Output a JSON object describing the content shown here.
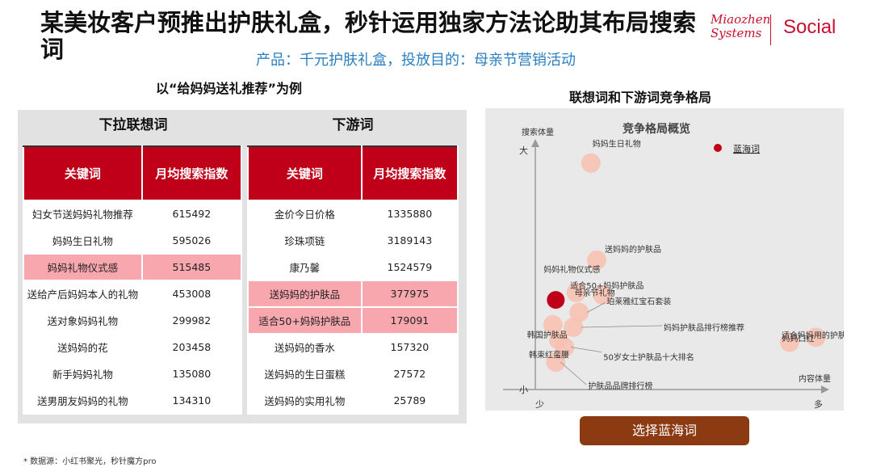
{
  "header": {
    "title": "某美妆客户预推出护肤礼盒，秒针运用独家方法论助其布局搜索词",
    "subtitle": "产品：千元护肤礼盒，投放目的：母亲节营销活动",
    "example": "以“给妈妈送礼推荐”为例"
  },
  "logo": {
    "miaozhen_line1": "Miaozhen",
    "miaozhen_line2": "Systems",
    "social": "Social"
  },
  "left_table": {
    "title": "下拉联想词",
    "col_keyword": "关键词",
    "col_index": "月均搜索指数",
    "rows": [
      {
        "kw": "妇女节送妈妈礼物推荐",
        "val": "615492"
      },
      {
        "kw": "妈妈生日礼物",
        "val": "595026"
      },
      {
        "kw": "妈妈礼物仪式感",
        "val": "515485"
      },
      {
        "kw": "送给产后妈妈本人的礼物",
        "val": "453008"
      },
      {
        "kw": "送对象妈妈礼物",
        "val": "299982"
      },
      {
        "kw": "送妈妈的花",
        "val": "203458"
      },
      {
        "kw": "新手妈妈礼物",
        "val": "135080"
      },
      {
        "kw": "送男朋友妈妈的礼物",
        "val": "134310"
      }
    ]
  },
  "right_table": {
    "title": "下游词",
    "col_keyword": "关键词",
    "col_index": "月均搜索指数",
    "rows": [
      {
        "kw": "金价今日价格",
        "val": "1335880"
      },
      {
        "kw": "珍珠项链",
        "val": "3189143"
      },
      {
        "kw": "康乃馨",
        "val": "1524579"
      },
      {
        "kw": "送妈妈的护肤品",
        "val": "377975"
      },
      {
        "kw": "适合50+妈妈护肤品",
        "val": "179091"
      },
      {
        "kw": "送妈妈的香水",
        "val": "157320"
      },
      {
        "kw": "送妈妈的生日蛋糕",
        "val": "27572"
      },
      {
        "kw": "送妈妈的实用礼物",
        "val": "25789"
      }
    ]
  },
  "chart_section_title": "联想词和下游词竞争格局",
  "chart_data": {
    "type": "scatter",
    "title": "竞争格局概览",
    "ylabel": "搜索体量",
    "xlabel": "内容体量",
    "y_high": "大",
    "y_low": "小",
    "x_low": "少",
    "x_high": "多",
    "legend": "蓝海词",
    "colors": {
      "bubble": "#f8c0b0",
      "blue_ocean": "#c00018",
      "axis": "#999999"
    },
    "points": [
      {
        "label": "妈妈生日礼物",
        "x": 0.19,
        "y": 0.91,
        "highlight": false
      },
      {
        "label": "送妈妈的护肤品",
        "x": 0.21,
        "y": 0.52,
        "highlight": false
      },
      {
        "label": "妈妈礼物仪式感",
        "x": 0.07,
        "y": 0.36,
        "highlight": true
      },
      {
        "label": "母亲节礼物",
        "x": 0.14,
        "y": 0.39,
        "highlight": false
      },
      {
        "label": "适合50+妈妈护肤品",
        "x": 0.23,
        "y": 0.38,
        "highlight": false
      },
      {
        "label": "珀莱雅红宝石套装",
        "x": 0.15,
        "y": 0.31,
        "highlight": false
      },
      {
        "label": "妈妈护肤品排行榜推荐",
        "x": 0.13,
        "y": 0.25,
        "highlight": false
      },
      {
        "label": "韩国护肤品",
        "x": 0.06,
        "y": 0.26,
        "highlight": false
      },
      {
        "label": "韩束红蛮腰",
        "x": 0.08,
        "y": 0.2,
        "highlight": false
      },
      {
        "label": "50岁女士护肤品十大排名",
        "x": 0.1,
        "y": 0.17,
        "highlight": false
      },
      {
        "label": "护肤品品牌排行榜",
        "x": 0.07,
        "y": 0.11,
        "highlight": false
      },
      {
        "label": "适合妈妈用的护肤品",
        "x": 0.87,
        "y": 0.19,
        "highlight": false
      },
      {
        "label": "妈妈口红",
        "x": 0.96,
        "y": 0.21,
        "highlight": false
      }
    ]
  },
  "cta": {
    "label": "选择蓝海词"
  },
  "footer": {
    "source": "* 数据源：小红书聚光，秒针魔方pro"
  }
}
